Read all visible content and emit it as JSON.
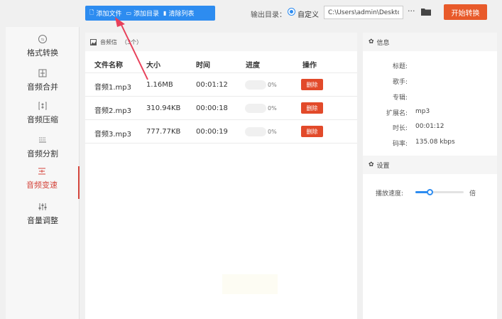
{
  "toolbar": {
    "add_file": "添加文件",
    "add_folder": "添加目录",
    "clear_list": "清除列表",
    "output_label": "输出目录：",
    "radio_label": "自定义",
    "output_path": "C:\\Users\\admin\\Deskto",
    "more": "···",
    "start": "开始转换"
  },
  "sidebar": {
    "items": [
      {
        "label": "格式转换",
        "icon": "format-convert-icon"
      },
      {
        "label": "音频合并",
        "icon": "audio-merge-icon"
      },
      {
        "label": "音频压缩",
        "icon": "audio-compress-icon"
      },
      {
        "label": "音频分割",
        "icon": "audio-split-icon"
      },
      {
        "label": "音频变速",
        "icon": "audio-speed-icon",
        "active": true
      },
      {
        "label": "音量调整",
        "icon": "volume-adjust-icon"
      }
    ]
  },
  "list": {
    "header": "音频信",
    "count": "（3个）",
    "columns": [
      "文件名称",
      "大小",
      "时间",
      "进度",
      "操作"
    ],
    "rows": [
      {
        "name": "音频1.mp3",
        "size": "1.16MB",
        "time": "00:01:12",
        "progress": "0%",
        "action": "删除"
      },
      {
        "name": "音频2.mp3",
        "size": "310.94KB",
        "time": "00:00:18",
        "progress": "0%",
        "action": "删除"
      },
      {
        "name": "音频3.mp3",
        "size": "777.77KB",
        "time": "00:00:19",
        "progress": "0%",
        "action": "删除"
      }
    ]
  },
  "info": {
    "title": "信息",
    "fields": [
      {
        "key": "标题:",
        "value": ""
      },
      {
        "key": "歌手:",
        "value": ""
      },
      {
        "key": "专辑:",
        "value": ""
      },
      {
        "key": "扩展名:",
        "value": "mp3"
      },
      {
        "key": "时长:",
        "value": "00:01:12"
      },
      {
        "key": "码率:",
        "value": "135.08 kbps"
      }
    ]
  },
  "settings": {
    "title": "设置",
    "speed_label": "播放速度:",
    "speed_unit": "倍",
    "speed_fraction": 0.3
  },
  "colors": {
    "accent": "#2d8cf0",
    "start_button": "#e85a2a",
    "delete_button": "#e24a2a",
    "active_nav": "#d4453c",
    "arrow": "#e8405a"
  }
}
